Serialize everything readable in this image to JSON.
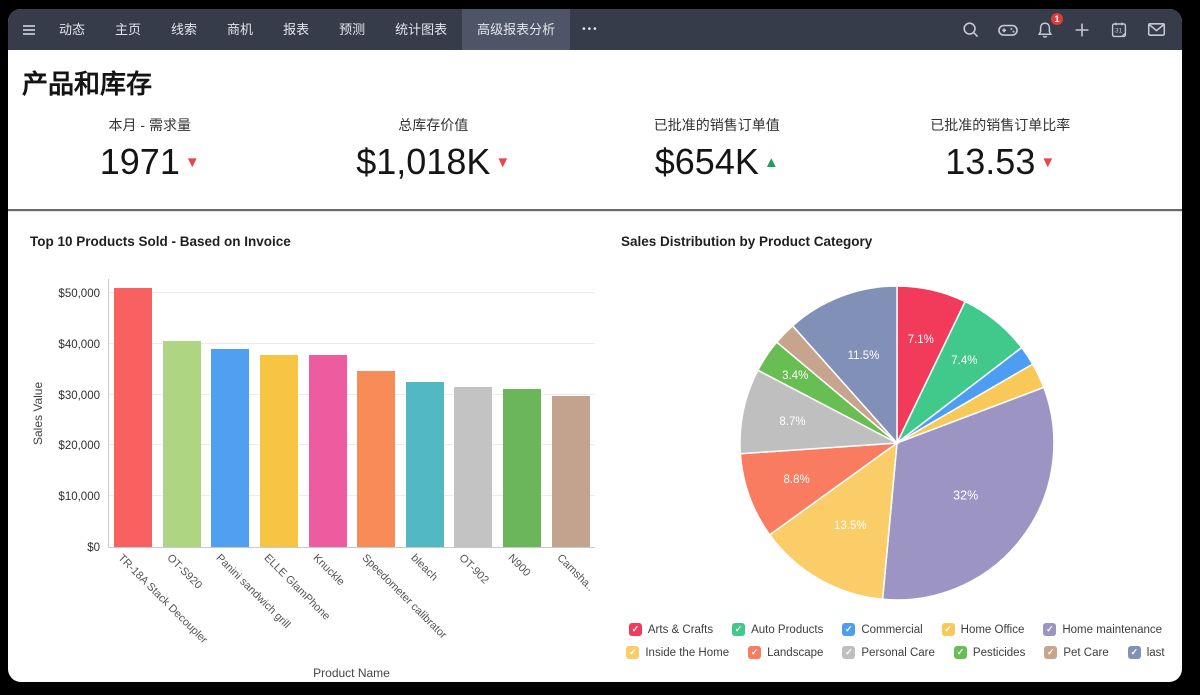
{
  "nav": {
    "items": [
      "动态",
      "主页",
      "线索",
      "商机",
      "报表",
      "预测",
      "统计图表",
      "高级报表分析"
    ],
    "active": "高级报表分析",
    "more_label": "•••",
    "left_icon": "hamburger-icon",
    "right_icons": [
      "search-icon",
      "gamepad-icon",
      "bell-icon",
      "plus-icon",
      "calendar-icon",
      "mail-icon"
    ],
    "bell_badge": "1"
  },
  "page": {
    "title": "产品和库存"
  },
  "kpis": [
    {
      "label": "本月 - 需求量",
      "value": "1971",
      "trend": "down"
    },
    {
      "label": "总库存价值",
      "value": "$1,018K",
      "trend": "down"
    },
    {
      "label": "已批准的销售订单值",
      "value": "$654K",
      "trend": "up"
    },
    {
      "label": "已批准的销售订单比率",
      "value": "13.53",
      "trend": "down"
    }
  ],
  "colors": {
    "trend_up": "#1FA05A",
    "trend_down": "#E8464D",
    "nav_bg": "#363C4A",
    "nav_active_bg": "#4D5566",
    "badge_red": "#E23B3B"
  },
  "chart_data": [
    {
      "type": "bar",
      "title": "Top 10 Products Sold - Based on Invoice",
      "xlabel": "Product Name",
      "ylabel": "Sales Value",
      "ylim": [
        0,
        52000
      ],
      "grid": true,
      "ytick_labels": [
        "$0",
        "$10,000",
        "$20,000",
        "$30,000",
        "$40,000",
        "$50,000"
      ],
      "categories": [
        "TR-18A Stack Decoupler",
        "OT-S920",
        "Panini sandwich grill",
        "ELLE GlamPhone",
        "Knuckle",
        "Speedometer calibrator",
        "bleach",
        "OT-902",
        "N900",
        "Camsha.."
      ],
      "values": [
        50900,
        40500,
        38900,
        37900,
        37800,
        34600,
        32400,
        31500,
        31200,
        29700
      ],
      "colors": [
        "#F8615F",
        "#AED581",
        "#509FF0",
        "#F7C443",
        "#EC5C9E",
        "#F78C58",
        "#52B9C2",
        "#C3C3C3",
        "#6BB65B",
        "#C3A28E"
      ]
    },
    {
      "type": "pie",
      "title": "Sales Distribution by Product Category",
      "legend_position": "bottom",
      "series": [
        {
          "label": "Arts & Crafts",
          "value": 7.1,
          "pct_label": "7.1%",
          "color": "#F23A5B"
        },
        {
          "label": "Auto Products",
          "value": 7.4,
          "pct_label": "7.4%",
          "color": "#41C98B"
        },
        {
          "label": "Commercial",
          "value": 2.0,
          "pct_label": "",
          "color": "#4D9EF2"
        },
        {
          "label": "Home Office",
          "value": 2.6,
          "pct_label": "",
          "color": "#F8C858"
        },
        {
          "label": "Home maintenance",
          "value": 32.0,
          "pct_label": "32%",
          "color": "#9C94C2"
        },
        {
          "label": "Inside the Home",
          "value": 13.5,
          "pct_label": "13.5%",
          "color": "#FACD69"
        },
        {
          "label": "Landscape",
          "value": 8.8,
          "pct_label": "8.8%",
          "color": "#F97B60"
        },
        {
          "label": "Personal Care",
          "value": 8.7,
          "pct_label": "8.7%",
          "color": "#BFBFBF"
        },
        {
          "label": "Pesticides",
          "value": 3.4,
          "pct_label": "3.4%",
          "color": "#68BE52"
        },
        {
          "label": "Pet Care",
          "value": 2.3,
          "pct_label": "",
          "color": "#C6A48E"
        },
        {
          "label": "last",
          "value": 11.5,
          "pct_label": "11.5%",
          "color": "#8190B6"
        }
      ]
    }
  ]
}
